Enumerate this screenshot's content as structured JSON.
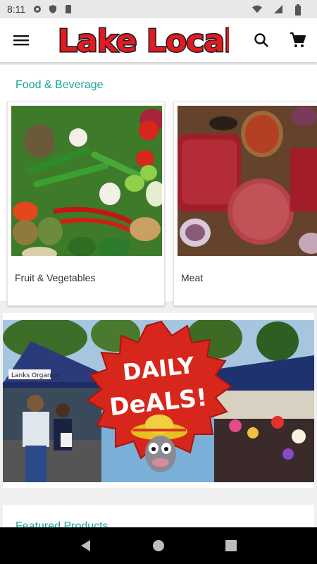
{
  "status_bar": {
    "time": "8:11"
  },
  "app_bar": {
    "logo_text": "Lake Local"
  },
  "section": {
    "title": "Food & Beverage",
    "categories": [
      {
        "label": "Fruit & Vegetables"
      },
      {
        "label": "Meat"
      }
    ]
  },
  "banner": {
    "sign_text": "Lanks Organics",
    "line1": "DAILY",
    "line2": "DeALS!"
  },
  "featured": {
    "title": "Featured Products"
  },
  "colors": {
    "accent": "#17a59a",
    "logo": "#e01b22"
  }
}
